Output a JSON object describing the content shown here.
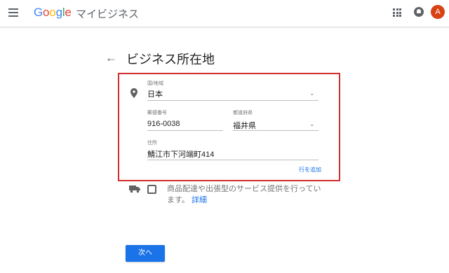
{
  "header": {
    "logo_letters": [
      "G",
      "o",
      "o",
      "g",
      "l",
      "e"
    ],
    "product_name": "マイビジネス",
    "avatar_initial": "A",
    "brand_colors": [
      "#4285F4",
      "#EA4335",
      "#FBBC05",
      "#34A853"
    ],
    "avatar_color": "#d84315"
  },
  "page": {
    "title": "ビジネス所在地"
  },
  "form": {
    "country": {
      "label": "国/地域",
      "value": "日本"
    },
    "postal_code": {
      "label": "郵便番号",
      "value": "916-0038"
    },
    "prefecture": {
      "label": "都道府県",
      "value": "福井県"
    },
    "address": {
      "label": "住所",
      "value": "鯖江市下河端町414"
    },
    "add_line_label": "行を追加",
    "highlight_color": "#d32f2f"
  },
  "service": {
    "text": "商品配達や出張型のサービス提供を行っています。",
    "detail_link": "詳細"
  },
  "footer": {
    "next_label": "次へ"
  },
  "icons": [
    "menu-icon",
    "apps-icon",
    "notification-icon",
    "back-arrow-icon",
    "location-pin-icon",
    "truck-icon",
    "chevron-down-icon"
  ]
}
